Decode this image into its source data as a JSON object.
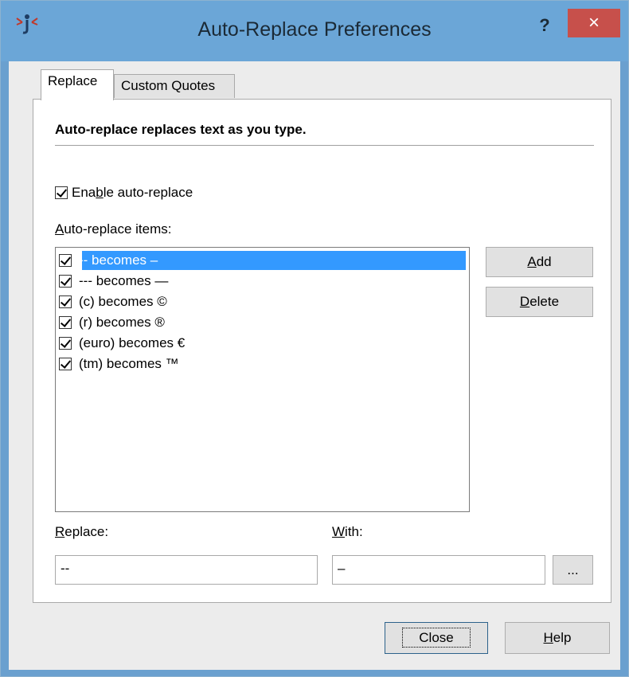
{
  "window": {
    "title": "Auto-Replace Preferences",
    "help_glyph": "?",
    "close_glyph": "×"
  },
  "tabs": [
    {
      "label": "Replace",
      "active": true
    },
    {
      "label": "Custom Quotes",
      "active": false
    }
  ],
  "panel": {
    "heading": "Auto-replace replaces text as you type.",
    "enable": {
      "label_pre": "Ena",
      "label_key": "b",
      "label_post": "le auto-replace",
      "checked": true
    },
    "items_label_key": "A",
    "items_label_rest": "uto-replace items:",
    "items": [
      {
        "text": "-- becomes –",
        "checked": true,
        "selected": true
      },
      {
        "text": "--- becomes —",
        "checked": true,
        "selected": false
      },
      {
        "text": "(c) becomes ©",
        "checked": true,
        "selected": false
      },
      {
        "text": "(r) becomes ®",
        "checked": true,
        "selected": false
      },
      {
        "text": "(euro) becomes €",
        "checked": true,
        "selected": false
      },
      {
        "text": "(tm) becomes ™",
        "checked": true,
        "selected": false
      }
    ],
    "add_button": {
      "key": "A",
      "rest": "dd"
    },
    "delete_button": {
      "key": "D",
      "rest": "elete"
    },
    "replace_label": {
      "key": "R",
      "rest": "eplace:"
    },
    "with_label": {
      "key": "W",
      "rest": "ith:"
    },
    "replace_value": "--",
    "with_value": "–",
    "browse_button": "..."
  },
  "footer": {
    "close_button": "Close",
    "help_button": {
      "key": "H",
      "rest": "elp"
    }
  },
  "colors": {
    "titlebar": "#6ba6d7",
    "close_button": "#c7504b",
    "selection": "#3399ff"
  }
}
